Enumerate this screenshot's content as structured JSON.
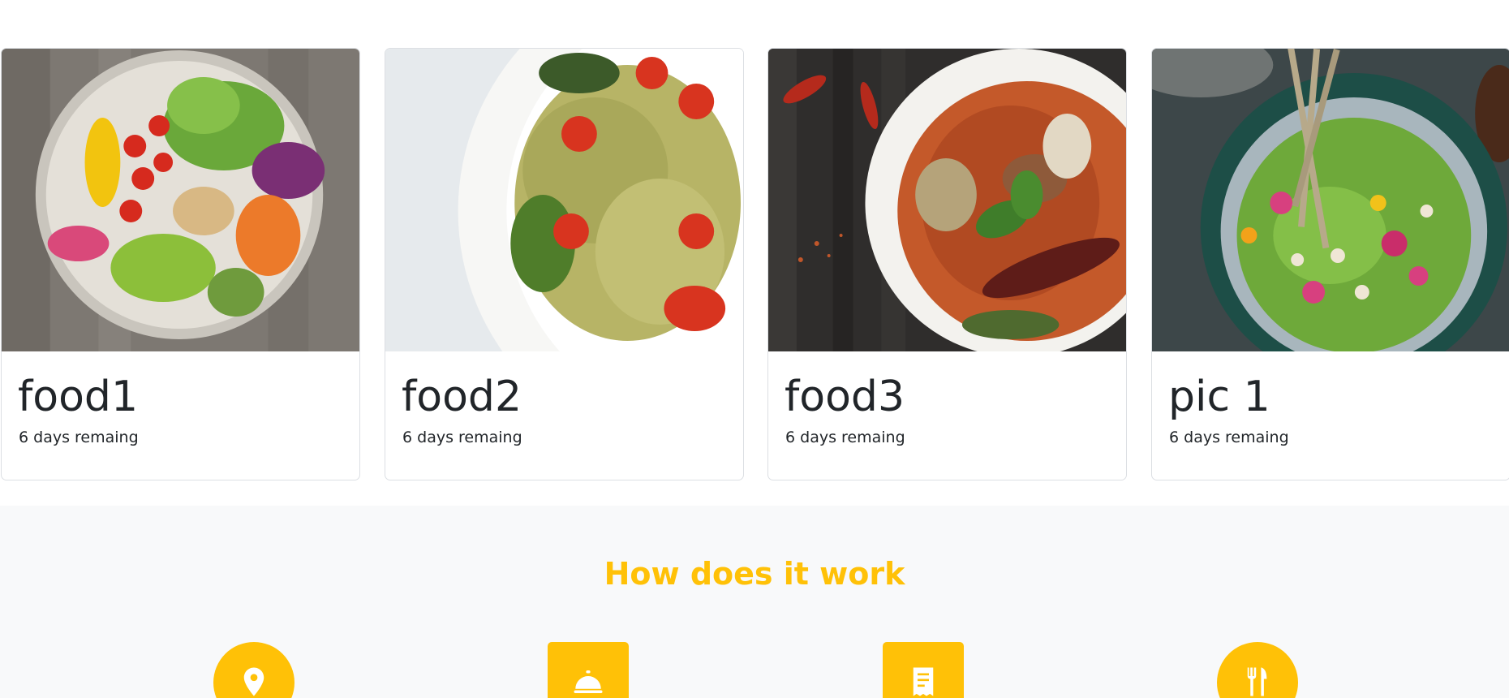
{
  "cards": [
    {
      "title": "food1",
      "subtitle": "6 days remaing",
      "image": "salad-bowl-photo"
    },
    {
      "title": "food2",
      "subtitle": "6 days remaing",
      "image": "pasta-salad-photo"
    },
    {
      "title": "food3",
      "subtitle": "6 days remaing",
      "image": "curry-bowl-photo"
    },
    {
      "title": "pic 1",
      "subtitle": "6 days remaing",
      "image": "hummus-bowl-photo"
    }
  ],
  "how": {
    "title": "How does it work",
    "title_color": "#ffc107",
    "steps": [
      {
        "icon": "location-pin-icon"
      },
      {
        "icon": "service-bell-icon"
      },
      {
        "icon": "receipt-icon"
      },
      {
        "icon": "fork-knife-icon"
      }
    ]
  },
  "colors": {
    "accent": "#ffc107",
    "section_bg": "#f8f9fa",
    "text": "#212529"
  }
}
